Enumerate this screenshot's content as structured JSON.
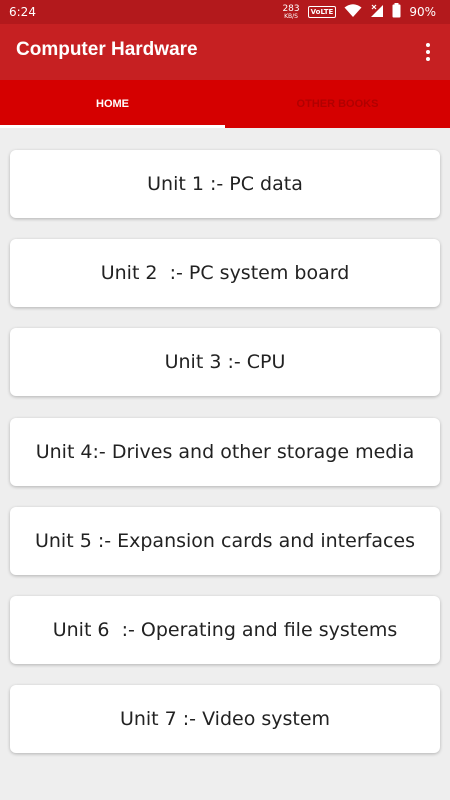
{
  "status_bar": {
    "time": "6:24",
    "net_speed_value": "283",
    "net_speed_unit": "KB/S",
    "volte": "VoLTE",
    "battery": "90%"
  },
  "app_bar": {
    "title": "Computer Hardware"
  },
  "tabs": [
    {
      "label": "HOME",
      "selected": true
    },
    {
      "label": "OTHER BOOKS",
      "selected": false
    }
  ],
  "units": [
    {
      "label": "Unit 1 :- PC data"
    },
    {
      "label": "Unit 2  :- PC system board"
    },
    {
      "label": "Unit 3 :- CPU"
    },
    {
      "label": "Unit 4:- Drives and other storage media"
    },
    {
      "label": "Unit 5 :- Expansion cards and interfaces"
    },
    {
      "label": "Unit 6  :- Operating and file systems"
    },
    {
      "label": "Unit 7 :- Video system"
    }
  ],
  "colors": {
    "status_bar": "#b3191c",
    "app_bar": "#c62022",
    "tab_bar": "#d50000",
    "background": "#eeeeee"
  }
}
